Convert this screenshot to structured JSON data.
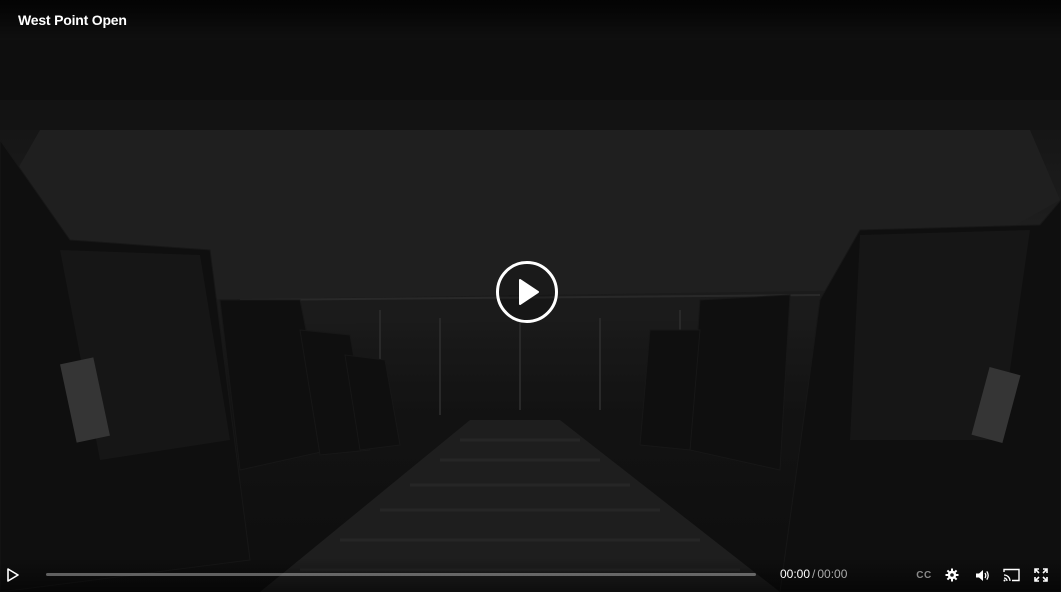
{
  "video": {
    "title": "West Point Open",
    "playback_progress": 0
  },
  "controls": {
    "current_time": "00:00",
    "separator": "/",
    "duration": "00:00",
    "captions_label": "CC"
  },
  "icons": {
    "big_play": "play-circle-icon",
    "play": "play-icon",
    "settings": "gear-icon",
    "volume": "volume-icon",
    "cast": "cast-icon",
    "fullscreen": "fullscreen-icon"
  },
  "colors": {
    "accent": "#ffffff",
    "muted": "#aaaaaa",
    "track": "#5a5a5a"
  }
}
